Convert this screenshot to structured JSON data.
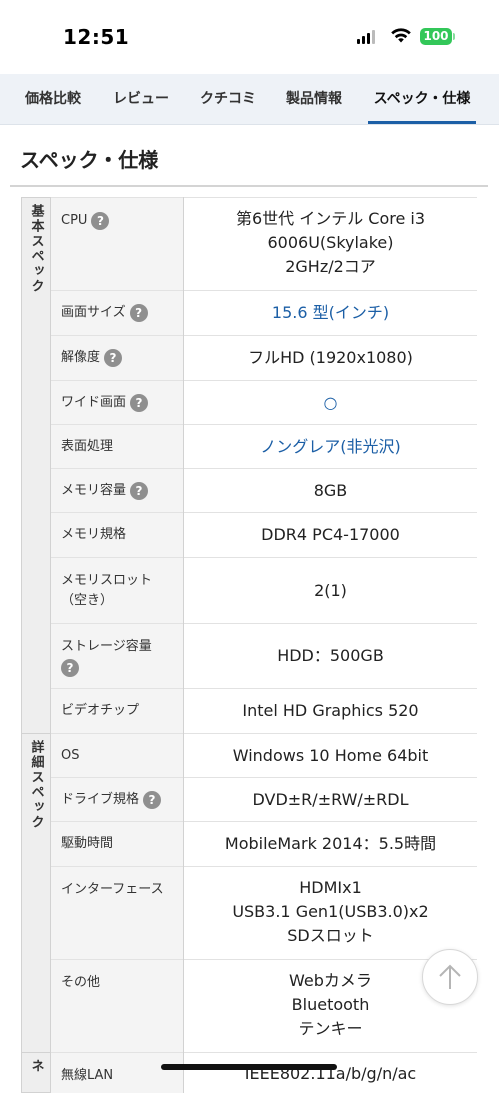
{
  "status_bar": {
    "time": "12:51",
    "battery": "100"
  },
  "tabs": [
    {
      "label": "価格比較",
      "active": false
    },
    {
      "label": "レビュー",
      "active": false
    },
    {
      "label": "クチコミ",
      "active": false
    },
    {
      "label": "製品情報",
      "active": false
    },
    {
      "label": "スペック・仕様",
      "active": true
    }
  ],
  "section_title": "スペック・仕様",
  "help_glyph": "?",
  "categories": {
    "basic": "基本スペック",
    "detail": "詳細スペック",
    "network": "ネ"
  },
  "rows": [
    {
      "label": "CPU",
      "value": "第6世代 インテル Core i3\n6006U(Skylake)\n2GHz/2コア"
    },
    {
      "label": "画面サイズ",
      "value": "15.6 型(インチ)"
    },
    {
      "label": "解像度",
      "value": "フルHD (1920x1080)"
    },
    {
      "label": "ワイド画面",
      "value": "○"
    },
    {
      "label": "表面処理",
      "value": "ノングレア(非光沢)"
    },
    {
      "label": "メモリ容量",
      "value": "8GB"
    },
    {
      "label": "メモリ規格",
      "value": "DDR4 PC4-17000"
    },
    {
      "label": "メモリスロット\n（空き）",
      "value": "2(1)"
    },
    {
      "label": "ストレージ容量",
      "value": "HDD：500GB"
    },
    {
      "label": "ビデオチップ",
      "value": "Intel HD Graphics 520"
    },
    {
      "label": "OS",
      "value": "Windows 10 Home 64bit"
    },
    {
      "label": "ドライブ規格",
      "value": "DVD±R/±RW/±RDL"
    },
    {
      "label": "駆動時間",
      "value": "MobileMark 2014：5.5時間"
    },
    {
      "label": "インターフェース",
      "value": "HDMIx1\nUSB3.1 Gen1(USB3.0)x2\nSDスロット"
    },
    {
      "label": "その他",
      "value": "Webカメラ\nBluetooth\nテンキー"
    },
    {
      "label": "無線LAN",
      "value": "IEEE802.11a/b/g/n/ac"
    }
  ],
  "colors": {
    "accent": "#1c5fa6",
    "tab_bg": "#eef2f7",
    "label_bg": "#f4f4f4",
    "category_bg": "#eeeeee"
  }
}
